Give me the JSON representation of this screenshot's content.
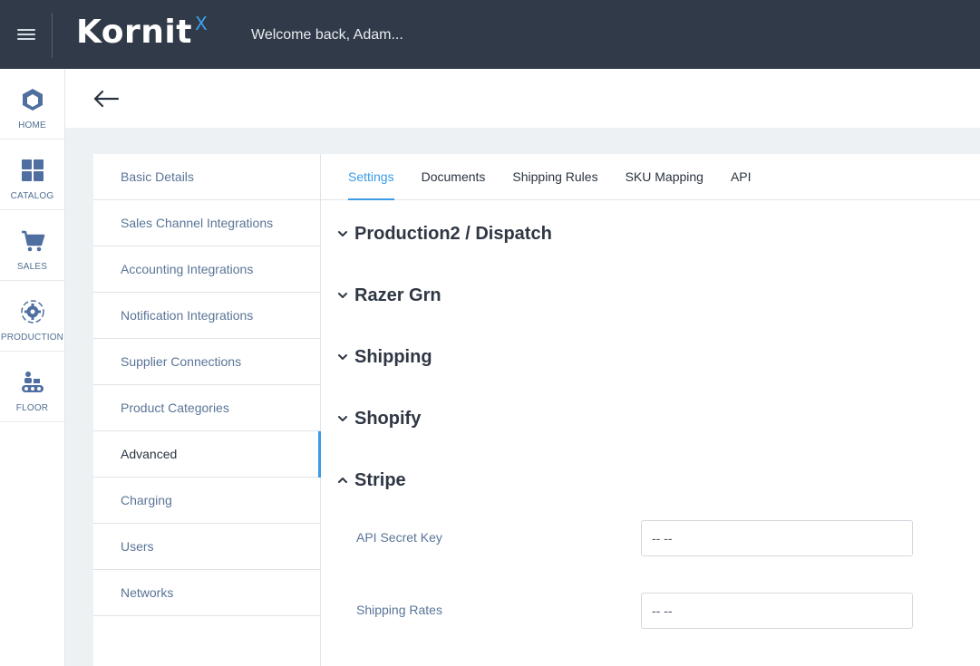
{
  "header": {
    "logo_text": "Kornit",
    "logo_suffix": "X",
    "welcome": "Welcome back, Adam..."
  },
  "nav": {
    "items": [
      {
        "label": "HOME",
        "icon": "home-hexagon-icon"
      },
      {
        "label": "CATALOG",
        "icon": "grid-icon"
      },
      {
        "label": "SALES",
        "icon": "cart-icon"
      },
      {
        "label": "PRODUCTION",
        "icon": "production-gear-icon"
      },
      {
        "label": "FLOOR",
        "icon": "conveyor-icon"
      }
    ]
  },
  "settings_menu": {
    "items": [
      "Basic Details",
      "Sales Channel Integrations",
      "Accounting Integrations",
      "Notification Integrations",
      "Supplier Connections",
      "Product Categories",
      "Advanced",
      "Charging",
      "Users",
      "Networks"
    ],
    "active": "Advanced"
  },
  "tabs": {
    "items": [
      "Settings",
      "Documents",
      "Shipping Rules",
      "SKU Mapping",
      "API"
    ],
    "active": "Settings"
  },
  "sections": [
    {
      "title": "Production2 / Dispatch",
      "expanded": false
    },
    {
      "title": "Razer Grn",
      "expanded": false
    },
    {
      "title": "Shipping",
      "expanded": false
    },
    {
      "title": "Shopify",
      "expanded": false
    },
    {
      "title": "Stripe",
      "expanded": true
    }
  ],
  "stripe_fields": [
    {
      "label": "API Secret Key",
      "placeholder": "-- --"
    },
    {
      "label": "Shipping Rates",
      "placeholder": "-- --"
    }
  ],
  "colors": {
    "topbar": "#313a48",
    "accent": "#3a9be6",
    "nav_text": "#4f6d94"
  }
}
